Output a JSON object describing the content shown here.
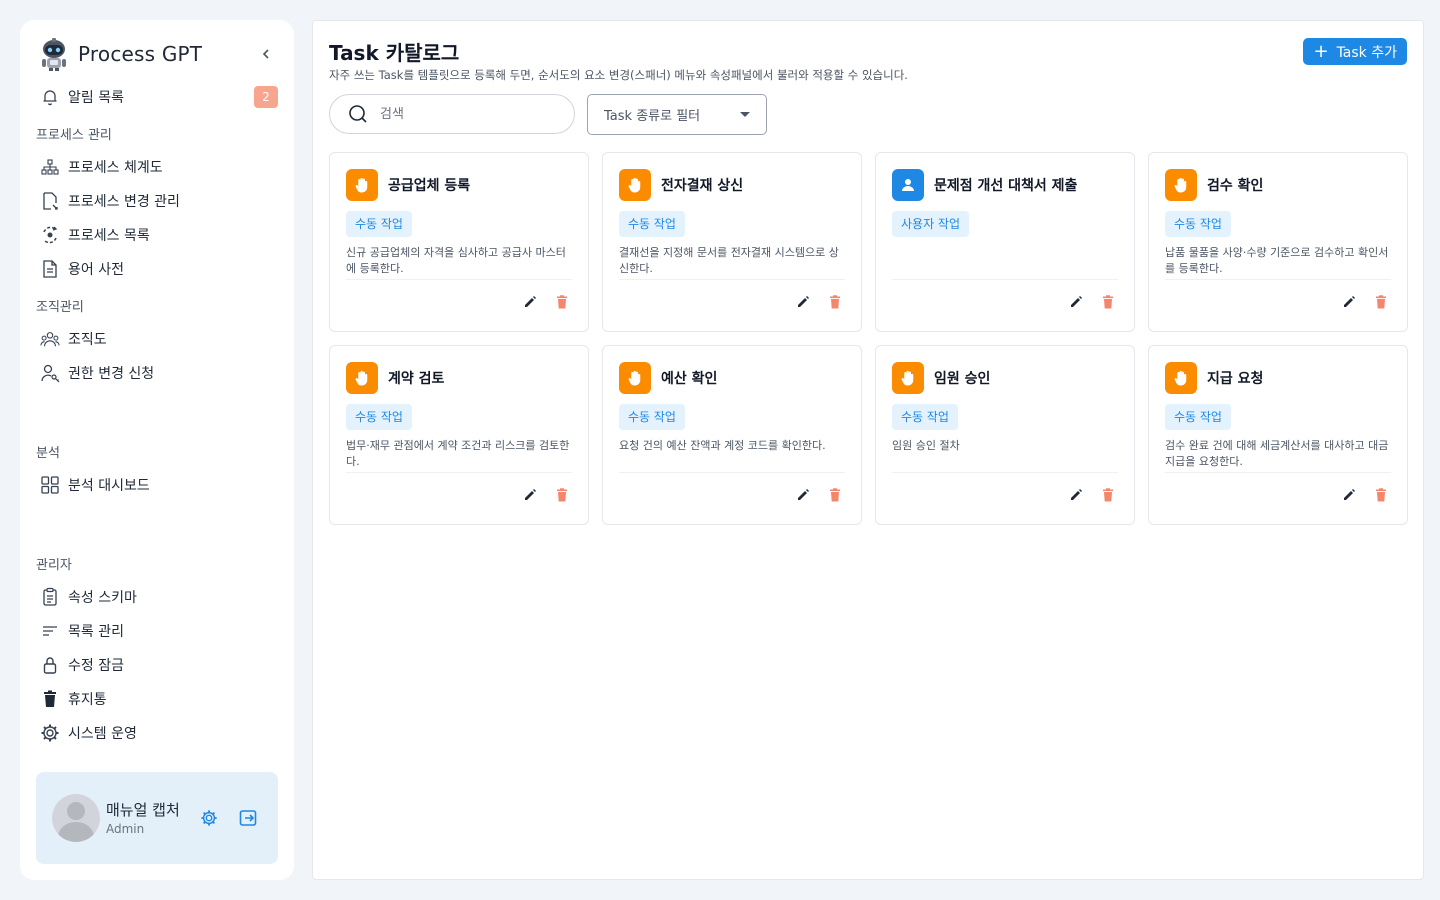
{
  "sidebar": {
    "brand": "Process GPT",
    "notifications": {
      "label": "알림 목록",
      "count": "2"
    },
    "sections": {
      "process": {
        "title": "프로세스 관리",
        "items": [
          "프로세스 체계도",
          "프로세스 변경 관리",
          "프로세스 목록",
          "용어 사전"
        ]
      },
      "org": {
        "title": "조직관리",
        "items": [
          "조직도",
          "권한 변경 신청"
        ]
      },
      "analysis": {
        "title": "분석",
        "items": [
          "분석 대시보드"
        ]
      },
      "admin": {
        "title": "관리자",
        "items": [
          "속성 스키마",
          "목록 관리",
          "수정 잠금",
          "휴지통",
          "시스템 운영"
        ]
      }
    },
    "profile": {
      "name": "매뉴얼 캡처",
      "role": "Admin"
    }
  },
  "main": {
    "title": "Task 카탈로그",
    "subtitle": "자주 쓰는 Task를 템플릿으로 등록해 두면, 순서도의 요소 변경(스패너) 메뉴와 속성패널에서 불러와 적용할 수 있습니다.",
    "add_button": "Task 추가",
    "search_placeholder": "검색",
    "filter_label": "Task 종류로 필터",
    "colors": {
      "manual": "#fb8c00",
      "user": "#1e88e5",
      "delete": "#f4866b",
      "edit": "#1f2937"
    },
    "cards": [
      {
        "title": "공급업체 등록",
        "type": "수동 작업",
        "icon": "hand-icon",
        "desc": "신규 공급업체의 자격을 심사하고 공급사 마스터에 등록한다."
      },
      {
        "title": "전자결재 상신",
        "type": "수동 작업",
        "icon": "hand-icon",
        "desc": "결재선을 지정해 문서를 전자결재 시스템으로 상신한다."
      },
      {
        "title": "문제점 개선 대책서 제출",
        "type": "사용자 작업",
        "icon": "user-icon",
        "desc": ""
      },
      {
        "title": "검수 확인",
        "type": "수동 작업",
        "icon": "hand-icon",
        "desc": "납품 물품을 사양·수량 기준으로 검수하고 확인서를 등록한다."
      },
      {
        "title": "계약 검토",
        "type": "수동 작업",
        "icon": "hand-icon",
        "desc": "법무·재무 관점에서 계약 조건과 리스크를 검토한다."
      },
      {
        "title": "예산 확인",
        "type": "수동 작업",
        "icon": "hand-icon",
        "desc": "요청 건의 예산 잔액과 계정 코드를 확인한다."
      },
      {
        "title": "임원 승인",
        "type": "수동 작업",
        "icon": "hand-icon",
        "desc": "임원 승인 절차"
      },
      {
        "title": "지급 요청",
        "type": "수동 작업",
        "icon": "hand-icon",
        "desc": "검수 완료 건에 대해 세금계산서를 대사하고 대금 지급을 요청한다."
      }
    ]
  }
}
